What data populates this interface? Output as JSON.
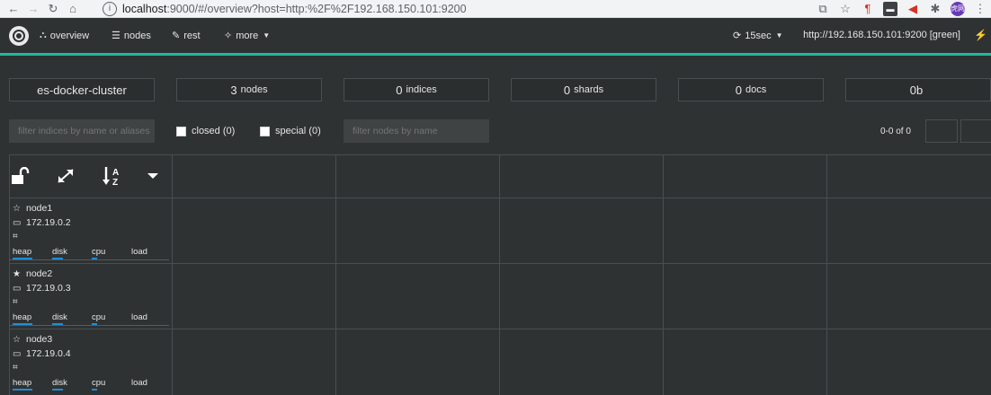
{
  "browser": {
    "url_host": "localhost",
    "url_rest": ":9000/#/overview?host=http:%2F%2F192.168.150.101:9200",
    "avatar_text": "虎网"
  },
  "header": {
    "menu": [
      {
        "label": "overview",
        "icon": "sitemap-icon"
      },
      {
        "label": "nodes",
        "icon": "server-icon"
      },
      {
        "label": "rest",
        "icon": "edit-icon"
      },
      {
        "label": "more",
        "icon": "magic-icon"
      }
    ],
    "refresh_label": "15sec",
    "cluster_url": "http://192.168.150.101:9200 [green]"
  },
  "stats": {
    "cluster_name": "es-docker-cluster",
    "nodes_num": "3",
    "nodes_label": "nodes",
    "indices_num": "0",
    "indices_label": "indices",
    "shards_num": "0",
    "shards_label": "shards",
    "docs_num": "0",
    "docs_label": "docs",
    "size": "0b"
  },
  "filters": {
    "indices_placeholder": "filter indices by name or aliases",
    "closed_label": "closed (0)",
    "special_label": "special (0)",
    "nodes_placeholder": "filter nodes by name",
    "pager": "0-0 of 0"
  },
  "metric_labels": [
    "heap",
    "disk",
    "cpu",
    "load"
  ],
  "nodes": [
    {
      "name": "node1",
      "ip": "172.19.0.2",
      "master": false
    },
    {
      "name": "node2",
      "ip": "172.19.0.3",
      "master": true
    },
    {
      "name": "node3",
      "ip": "172.19.0.4",
      "master": false
    }
  ],
  "colors": {
    "accent": "#1abc9c",
    "background": "#2f3233",
    "metric_bar": "#1f8dd6"
  }
}
